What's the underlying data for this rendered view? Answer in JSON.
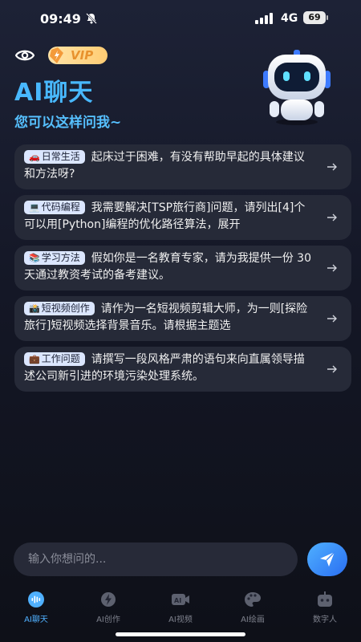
{
  "status_bar": {
    "time": "09:49",
    "network": "4G",
    "battery": "69"
  },
  "header": {
    "vip_label": "VIP",
    "title": "AI聊天",
    "subtitle": "您可以这样问我~"
  },
  "suggestions": [
    {
      "emoji": "🚗",
      "tag": "日常生活",
      "text": "起床过于困难，有没有帮助早起的具体建议和方法呀?"
    },
    {
      "emoji": "💻",
      "tag": "代码编程",
      "text": "我需要解决[TSP旅行商]问题，请列出[4]个可以用[Python]编程的优化路径算法，展开"
    },
    {
      "emoji": "📚",
      "tag": "学习方法",
      "text": "假如你是一名教育专家，请为我提供一份 30 天通过教资考试的备考建议。"
    },
    {
      "emoji": "📸",
      "tag": "短视频创作",
      "text": "请作为一名短视频剪辑大师，为一则[探险旅行]短视频选择背景音乐。请根据主题选"
    },
    {
      "emoji": "💼",
      "tag": "工作问题",
      "text": "请撰写一段风格严肃的语句来向直属领导描述公司新引进的环境污染处理系统。"
    }
  ],
  "input": {
    "placeholder": "输入你想问的..."
  },
  "nav": {
    "items": [
      {
        "label": "AI聊天",
        "icon": "voice-wave-icon",
        "active": true
      },
      {
        "label": "AI创作",
        "icon": "bolt-icon",
        "active": false
      },
      {
        "label": "AI视频",
        "icon": "ai-video-icon",
        "active": false
      },
      {
        "label": "AI绘画",
        "icon": "palette-icon",
        "active": false
      },
      {
        "label": "数字人",
        "icon": "robot-icon",
        "active": false
      }
    ]
  },
  "colors": {
    "accent": "#4fb0ff",
    "card_bg": "#262a38",
    "tag_bg": "#dbe6ff",
    "vip_bg": "#ffd385"
  }
}
